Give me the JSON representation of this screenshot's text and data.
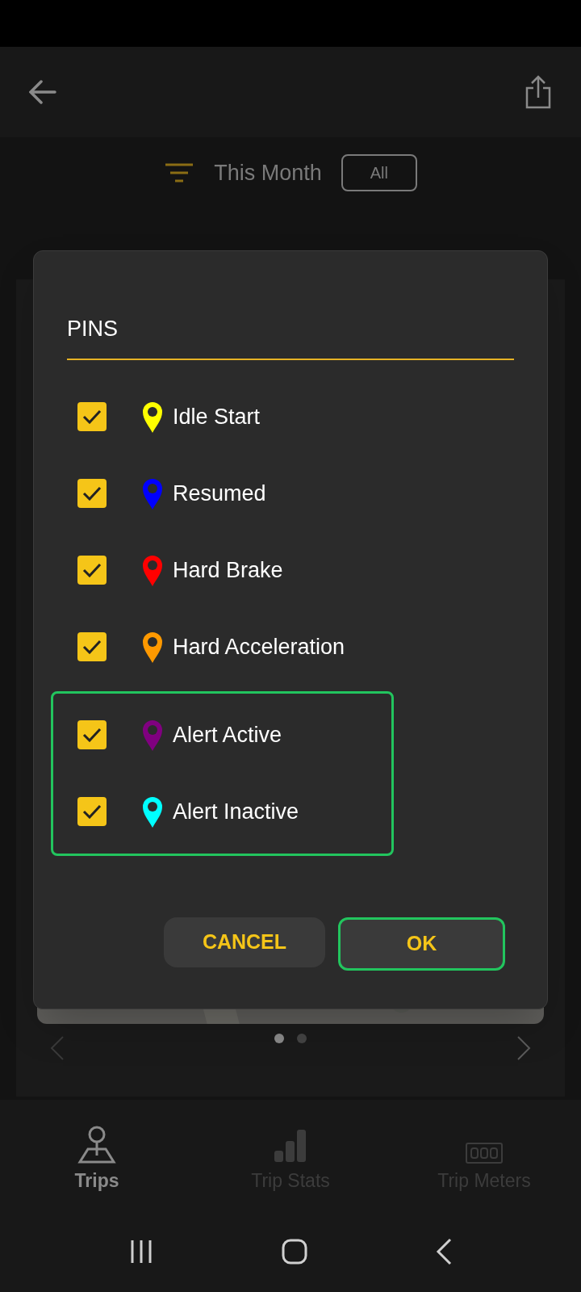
{
  "filter": {
    "label": "This Month",
    "button": "All"
  },
  "pager": {
    "dots": [
      {
        "selected": true
      },
      {
        "selected": false
      }
    ]
  },
  "dialog": {
    "title": "PINS",
    "groups": [
      {
        "highlighted": false,
        "items": [
          {
            "label": "Idle Start",
            "color": "#ffff00",
            "checked": true
          },
          {
            "label": "Resumed",
            "color": "#0000ff",
            "checked": true
          },
          {
            "label": "Hard Brake",
            "color": "#ff0000",
            "checked": true
          },
          {
            "label": "Hard Acceleration",
            "color": "#ff9900",
            "checked": true
          }
        ]
      },
      {
        "highlighted": true,
        "items": [
          {
            "label": "Alert Active",
            "color": "#800080",
            "checked": true
          },
          {
            "label": "Alert Inactive",
            "color": "#00ffff",
            "checked": true
          }
        ]
      }
    ],
    "buttons": [
      {
        "label": "CANCEL",
        "focused": false
      },
      {
        "label": "OK",
        "focused": true
      }
    ]
  },
  "bottom_nav": [
    {
      "label": "Trips",
      "kind": "pin",
      "selected": true
    },
    {
      "label": "Trip Stats",
      "kind": "stats",
      "selected": false
    },
    {
      "label": "Trip Meters",
      "kind": "meter",
      "selected": false
    }
  ]
}
